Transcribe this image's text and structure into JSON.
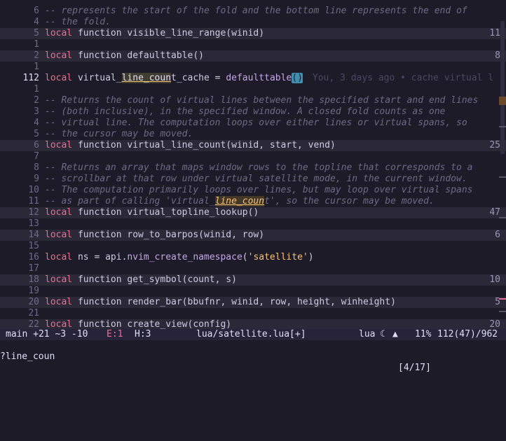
{
  "lines": [
    {
      "num": "6",
      "kind": "comment",
      "text": "-- represents the start of the fold and the bottom line represents the end of"
    },
    {
      "num": "4",
      "kind": "comment",
      "text": "-- the fold."
    },
    {
      "num": "5",
      "kind": "fold",
      "text": "local function visible_line_range(winid)",
      "count": "11"
    },
    {
      "num": "1",
      "kind": "blank"
    },
    {
      "num": "2",
      "kind": "fold",
      "text": "local function defaulttable()",
      "count": "8"
    },
    {
      "num": "1",
      "kind": "blank"
    },
    {
      "num": "112",
      "kind": "current",
      "current": true
    },
    {
      "num": "1",
      "kind": "blank"
    },
    {
      "num": "2",
      "kind": "comment",
      "text": "-- Returns the count of virtual lines between the specified start and end lines"
    },
    {
      "num": "3",
      "kind": "comment",
      "text": "-- (both inclusive), in the specified window. A closed fold counts as one"
    },
    {
      "num": "4",
      "kind": "comment",
      "text": "-- virtual line. The computation loops over either lines or virtual spans, so"
    },
    {
      "num": "5",
      "kind": "comment",
      "text": "-- the cursor may be moved."
    },
    {
      "num": "6",
      "kind": "fold",
      "text": "local function virtual_line_count(winid, start, vend)",
      "count": "25"
    },
    {
      "num": "7",
      "kind": "blank"
    },
    {
      "num": "8",
      "kind": "comment",
      "text": "-- Returns an array that maps window rows to the topline that corresponds to a"
    },
    {
      "num": "9",
      "kind": "comment",
      "text": "-- scrollbar at that row under virtual satellite mode, in the current window."
    },
    {
      "num": "10",
      "kind": "comment",
      "text": "-- The computation primarily loops over lines, but may loop over virtual spans"
    },
    {
      "num": "11",
      "kind": "search_comment"
    },
    {
      "num": "12",
      "kind": "fold",
      "text": "local function virtual_topline_lookup()",
      "count": "47"
    },
    {
      "num": "13",
      "kind": "blank"
    },
    {
      "num": "14",
      "kind": "fold",
      "text": "local function row_to_barpos(winid, row)",
      "count": "6"
    },
    {
      "num": "15",
      "kind": "blank"
    },
    {
      "num": "16",
      "kind": "ns"
    },
    {
      "num": "17",
      "kind": "blank"
    },
    {
      "num": "18",
      "kind": "fold",
      "text": "local function get_symbol(count, s)",
      "count": "10"
    },
    {
      "num": "19",
      "kind": "blank"
    },
    {
      "num": "20",
      "kind": "fold",
      "text": "local function render_bar(bbufnr, winid, row, height, winheight)",
      "count": "5"
    },
    {
      "num": "21",
      "kind": "blank"
    },
    {
      "num": "22",
      "kind": "fold",
      "text": "local function create_view(config)",
      "count": "20"
    }
  ],
  "current_line": {
    "kw": "local",
    "pre": " virtual_",
    "ref": "line_coun",
    "post": "t_cache = ",
    "fn": "defaulttable",
    "paren": "()",
    "blame": "You, 3 days ago • cache virtual l"
  },
  "search_comment": {
    "pre": "-- as part of calling 'virtual_",
    "match": "line_coun",
    "post": "t', so the cursor may be moved."
  },
  "ns_line": {
    "kw": "local",
    "mid": " ns = api.",
    "fn": "nvim_create_namespace",
    "open": "(",
    "str": "'satellite'",
    "close": ")"
  },
  "statusline": {
    "branch": "main +21 ~3 -10",
    "errors": "E:1",
    "hints": "H:3",
    "file": "lua/satellite.lua[+]",
    "filetype": "lua",
    "percent": "11%",
    "position": "112(47)/962"
  },
  "cmdline": {
    "query": "?line_coun",
    "match_count": "[4/17]"
  },
  "colors": {
    "background": "#1d1b27",
    "keyword": "#eb6f92",
    "function": "#c4a7e7",
    "string": "#f6c177",
    "comment": "#6e6a86",
    "error": "#eb6f92"
  }
}
